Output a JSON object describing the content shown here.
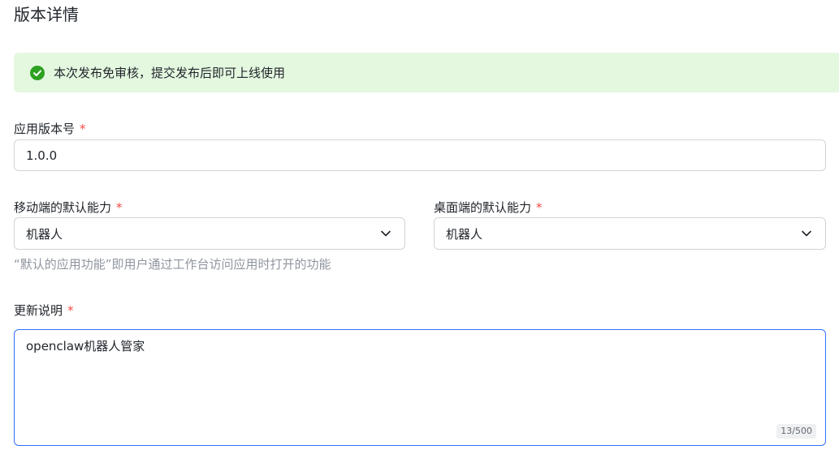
{
  "section": {
    "title": "版本详情"
  },
  "notice": {
    "icon": "check-circle-icon",
    "color": "#2ea121",
    "background": "#e4f8e0",
    "text": "本次发布免审核，提交发布后即可上线使用"
  },
  "version": {
    "label": "应用版本号",
    "required_mark": "*",
    "value": "1.0.0"
  },
  "mobile_default": {
    "label": "移动端的默认能力",
    "required_mark": "*",
    "selected": "机器人",
    "icon": "chevron-down-icon"
  },
  "desktop_default": {
    "label": "桌面端的默认能力",
    "required_mark": "*",
    "selected": "机器人",
    "icon": "chevron-down-icon"
  },
  "hint": "“默认的应用功能”即用户通过工作台访问应用时打开的功能",
  "release_notes": {
    "label": "更新说明",
    "required_mark": "*",
    "value": "openclaw机器人管家",
    "counter": "13/500"
  },
  "colors": {
    "required": "#f54a45",
    "focus_border": "#3370ff",
    "hint_text": "#8f959e"
  }
}
